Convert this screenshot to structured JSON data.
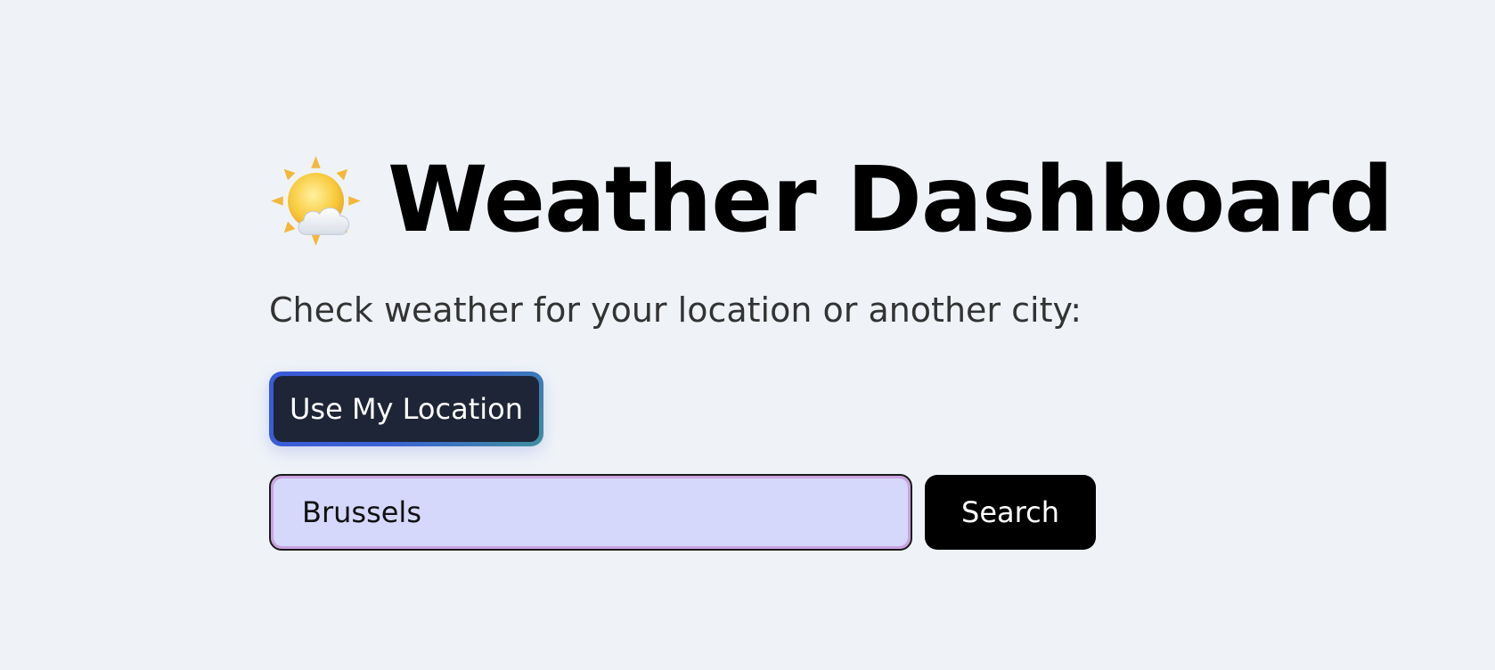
{
  "header": {
    "icon": "sun-behind-cloud-icon",
    "title": "Weather Dashboard"
  },
  "subtitle": "Check weather for your location or another city:",
  "location_button": {
    "label": "Use My Location"
  },
  "search": {
    "value": "Brussels",
    "button_label": "Search"
  },
  "colors": {
    "background": "#eff3f8",
    "location_button_bg": "#1e2537",
    "location_button_border": "#3b62d6",
    "input_bg": "#d5d8fa",
    "input_border": "#c9a4e0",
    "search_button_bg": "#000000"
  }
}
